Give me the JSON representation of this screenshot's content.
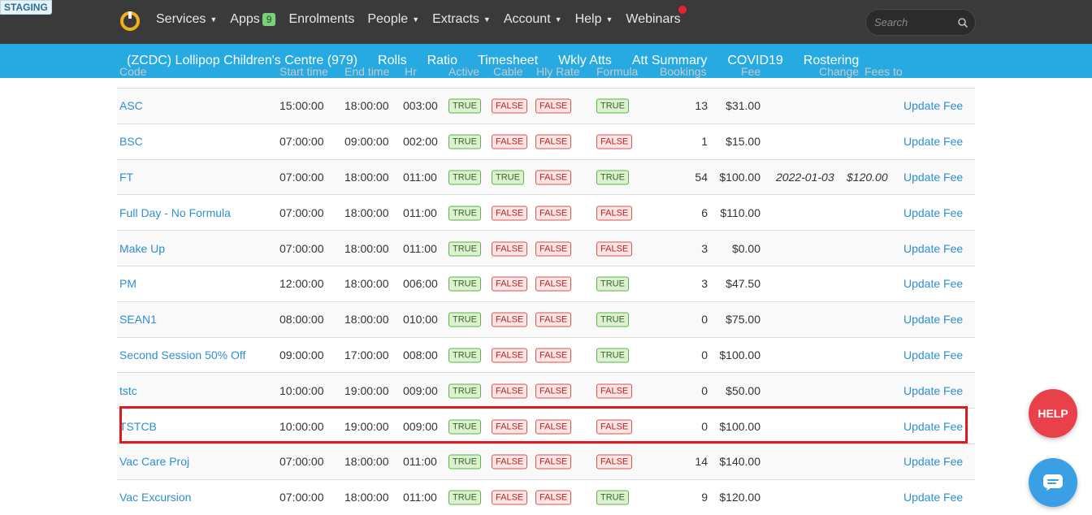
{
  "staging_label": "STAGING",
  "nav": {
    "items": [
      {
        "label": "Services",
        "caret": true
      },
      {
        "label": "Apps",
        "badge": "9"
      },
      {
        "label": "Enrolments"
      },
      {
        "label": "People",
        "caret": true
      },
      {
        "label": "Extracts",
        "caret": true
      },
      {
        "label": "Account",
        "caret": true
      },
      {
        "label": "Help",
        "caret": true
      },
      {
        "label": "Webinars"
      }
    ],
    "search_placeholder": "Search"
  },
  "subnav": {
    "items": [
      "(ZCDC) Lollipop Children's Centre (979)",
      "Rolls",
      "Ratio",
      "Timesheet",
      "Wkly Atts",
      "Att Summary",
      "COVID19",
      "Rostering"
    ]
  },
  "table": {
    "header_partial": [
      "Code",
      "Start time",
      "End time",
      "Hr",
      "Active",
      "Cable",
      "Hly Rate",
      "Formula",
      "Bookings",
      "Fee",
      "Change",
      "Fees to"
    ],
    "rows": [
      {
        "code": "ASC",
        "start": "15:00:00",
        "end": "18:00:00",
        "hrs": "003:00",
        "b1": "TRUE",
        "b2": "FALSE",
        "b3": "FALSE",
        "b4": "TRUE",
        "bookings": "13",
        "fee": "$31.00",
        "date": "",
        "new_fee": "",
        "action": "Update Fee"
      },
      {
        "code": "BSC",
        "start": "07:00:00",
        "end": "09:00:00",
        "hrs": "002:00",
        "b1": "TRUE",
        "b2": "FALSE",
        "b3": "FALSE",
        "b4": "FALSE",
        "bookings": "1",
        "fee": "$15.00",
        "date": "",
        "new_fee": "",
        "action": "Update Fee"
      },
      {
        "code": "FT",
        "start": "07:00:00",
        "end": "18:00:00",
        "hrs": "011:00",
        "b1": "TRUE",
        "b2": "TRUE",
        "b3": "FALSE",
        "b4": "TRUE",
        "bookings": "54",
        "fee": "$100.00",
        "date": "2022-01-03",
        "new_fee": "$120.00",
        "action": "Update Fee"
      },
      {
        "code": "Full Day - No Formula",
        "start": "07:00:00",
        "end": "18:00:00",
        "hrs": "011:00",
        "b1": "TRUE",
        "b2": "FALSE",
        "b3": "FALSE",
        "b4": "FALSE",
        "bookings": "6",
        "fee": "$110.00",
        "date": "",
        "new_fee": "",
        "action": "Update Fee"
      },
      {
        "code": "Make Up",
        "start": "07:00:00",
        "end": "18:00:00",
        "hrs": "011:00",
        "b1": "TRUE",
        "b2": "FALSE",
        "b3": "FALSE",
        "b4": "FALSE",
        "bookings": "3",
        "fee": "$0.00",
        "date": "",
        "new_fee": "",
        "action": "Update Fee"
      },
      {
        "code": "PM",
        "start": "12:00:00",
        "end": "18:00:00",
        "hrs": "006:00",
        "b1": "TRUE",
        "b2": "FALSE",
        "b3": "FALSE",
        "b4": "TRUE",
        "bookings": "3",
        "fee": "$47.50",
        "date": "",
        "new_fee": "",
        "action": "Update Fee"
      },
      {
        "code": "SEAN1",
        "start": "08:00:00",
        "end": "18:00:00",
        "hrs": "010:00",
        "b1": "TRUE",
        "b2": "FALSE",
        "b3": "FALSE",
        "b4": "TRUE",
        "bookings": "0",
        "fee": "$75.00",
        "date": "",
        "new_fee": "",
        "action": "Update Fee"
      },
      {
        "code": "Second Session 50% Off",
        "start": "09:00:00",
        "end": "17:00:00",
        "hrs": "008:00",
        "b1": "TRUE",
        "b2": "FALSE",
        "b3": "FALSE",
        "b4": "TRUE",
        "bookings": "0",
        "fee": "$100.00",
        "date": "",
        "new_fee": "",
        "action": "Update Fee"
      },
      {
        "code": "tstc",
        "start": "10:00:00",
        "end": "19:00:00",
        "hrs": "009:00",
        "b1": "TRUE",
        "b2": "FALSE",
        "b3": "FALSE",
        "b4": "FALSE",
        "bookings": "0",
        "fee": "$50.00",
        "date": "",
        "new_fee": "",
        "action": "Update Fee"
      },
      {
        "code": "TSTCB",
        "start": "10:00:00",
        "end": "19:00:00",
        "hrs": "009:00",
        "b1": "TRUE",
        "b2": "FALSE",
        "b3": "FALSE",
        "b4": "FALSE",
        "bookings": "0",
        "fee": "$100.00",
        "date": "",
        "new_fee": "",
        "action": "Update Fee"
      },
      {
        "code": "Vac Care Proj",
        "start": "07:00:00",
        "end": "18:00:00",
        "hrs": "011:00",
        "b1": "TRUE",
        "b2": "FALSE",
        "b3": "FALSE",
        "b4": "FALSE",
        "bookings": "14",
        "fee": "$140.00",
        "date": "",
        "new_fee": "",
        "action": "Update Fee"
      },
      {
        "code": "Vac Excursion",
        "start": "07:00:00",
        "end": "18:00:00",
        "hrs": "011:00",
        "b1": "TRUE",
        "b2": "FALSE",
        "b3": "FALSE",
        "b4": "TRUE",
        "bookings": "9",
        "fee": "$120.00",
        "date": "",
        "new_fee": "",
        "action": "Update Fee"
      }
    ]
  },
  "floating": {
    "help_label": "HELP",
    "chat_icon": "chat-bubble-icon"
  },
  "colors": {
    "topbar": "#3a3a3a",
    "subnav": "#27aae1",
    "link": "#2f8fcf",
    "true_badge": "#56b647",
    "false_badge": "#d9534f",
    "highlight": "#e0181f",
    "help": "#e8414a",
    "chat": "#3b9fe6"
  }
}
